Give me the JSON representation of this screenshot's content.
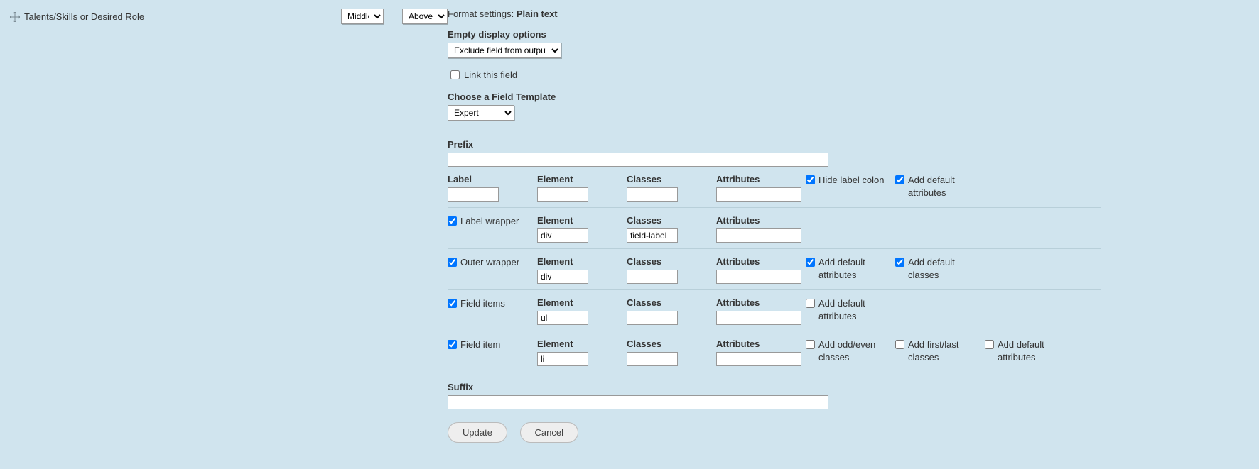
{
  "field": {
    "title": "Talents/Skills or Desired Role",
    "alignment": "Middle",
    "position": "Above"
  },
  "format": {
    "label": "Format settings:",
    "value": "Plain text"
  },
  "emptyDisplay": {
    "label": "Empty display options",
    "value": "Exclude field from output"
  },
  "linkThisField": {
    "label": "Link this field",
    "checked": false
  },
  "fieldTemplate": {
    "label": "Choose a Field Template",
    "value": "Expert"
  },
  "prefix": {
    "label": "Prefix",
    "value": ""
  },
  "suffix": {
    "label": "Suffix",
    "value": ""
  },
  "headers": {
    "label": "Label",
    "element": "Element",
    "classes": "Classes",
    "attributes": "Attributes"
  },
  "rows": {
    "labelRow": {
      "label": "",
      "element": "",
      "classes": "",
      "attributes": "",
      "hideLabelColon": {
        "label": "Hide label colon",
        "checked": true
      },
      "addDefaultAttrs": {
        "label": "Add default attributes",
        "checked": true
      }
    },
    "labelWrapper": {
      "name": "Label wrapper",
      "checked": true,
      "element": "div",
      "classes": "field-label",
      "attributes": ""
    },
    "outerWrapper": {
      "name": "Outer wrapper",
      "checked": true,
      "element": "div",
      "classes": "",
      "attributes": "",
      "addDefaultAttrs": {
        "label": "Add default attributes",
        "checked": true
      },
      "addDefaultClasses": {
        "label": "Add default classes",
        "checked": true
      }
    },
    "fieldItems": {
      "name": "Field items",
      "checked": true,
      "element": "ul",
      "classes": "",
      "attributes": "",
      "addDefaultAttrs": {
        "label": "Add default attributes",
        "checked": false
      }
    },
    "fieldItem": {
      "name": "Field item",
      "checked": true,
      "element": "li",
      "classes": "",
      "attributes": "",
      "addOddEven": {
        "label": "Add odd/even classes",
        "checked": false
      },
      "addFirstLast": {
        "label": "Add first/last classes",
        "checked": false
      },
      "addDefaultAttrs": {
        "label": "Add default attributes",
        "checked": false
      }
    }
  },
  "buttons": {
    "update": "Update",
    "cancel": "Cancel"
  }
}
